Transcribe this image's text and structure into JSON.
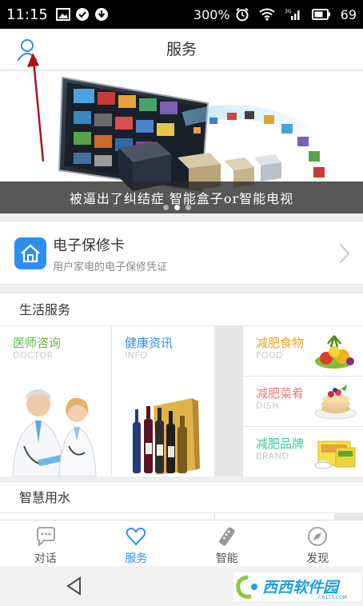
{
  "status_bar": {
    "time": "11:15",
    "battery_saver": "300%",
    "signal_label": "3G",
    "battery_level": "69"
  },
  "header": {
    "title": "服务"
  },
  "banner": {
    "caption": "被逼出了纠结症 智能盒子or智能电视",
    "active_slide": 1,
    "slide_count": 3
  },
  "warranty": {
    "title": "电子保修卡",
    "subtitle": "用户家电的电子保修凭证"
  },
  "life_services": {
    "heading": "生活服务",
    "tiles": [
      {
        "title": "医师咨询",
        "subtitle": "DOCTOR",
        "color": "#5cc13b"
      },
      {
        "title": "健康资讯",
        "subtitle": "INFO",
        "color": "#2e8ef2"
      },
      {
        "title": "减肥食物",
        "subtitle": "FOOD",
        "color": "#f0a321"
      },
      {
        "title": "减肥菜肴",
        "subtitle": "DISH",
        "color": "#ee7a7a"
      },
      {
        "title": "减肥品牌",
        "subtitle": "BRAND",
        "color": "#3cc7a0"
      }
    ]
  },
  "smart_water": {
    "heading": "智慧用水"
  },
  "tabs": [
    {
      "label": "对话",
      "icon": "chat-bubble-icon",
      "active": false
    },
    {
      "label": "服务",
      "icon": "heart-icon",
      "active": true
    },
    {
      "label": "智能",
      "icon": "remote-control-icon",
      "active": false
    },
    {
      "label": "发现",
      "icon": "compass-icon",
      "active": false
    }
  ],
  "watermark": {
    "text": "西西软件园",
    "domain": "CR173.COM"
  },
  "colors": {
    "accent": "#2e8ef2",
    "annotation_arrow": "#b0121b"
  }
}
